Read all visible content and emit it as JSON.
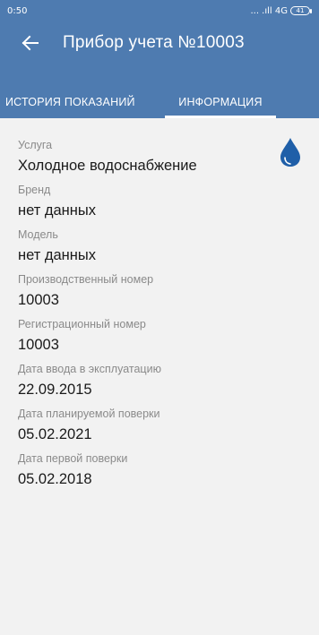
{
  "status_bar": {
    "time": "0:50",
    "network": "... .ıll 4G",
    "battery": "41"
  },
  "toolbar": {
    "title": "Прибор учета №10003",
    "back_icon": "arrow-left-icon"
  },
  "tabs": [
    {
      "label": "ИСТОРИЯ ПОКАЗАНИЙ",
      "active": false
    },
    {
      "label": "ИНФОРМАЦИЯ",
      "active": true
    }
  ],
  "colors": {
    "header": "#4e7bb0",
    "background": "#f2f2f2",
    "drop_icon": "#1f5fa8"
  },
  "service_icon": "water-drop-icon",
  "fields": [
    {
      "label": "Услуга",
      "value": "Холодное водоснабжение"
    },
    {
      "label": "Бренд",
      "value": "нет данных"
    },
    {
      "label": "Модель",
      "value": "нет данных"
    },
    {
      "label": "Производственный номер",
      "value": "10003"
    },
    {
      "label": "Регистрационный номер",
      "value": "10003"
    },
    {
      "label": "Дата ввода в эксплуатацию",
      "value": "22.09.2015"
    },
    {
      "label": "Дата планируемой поверки",
      "value": "05.02.2021"
    },
    {
      "label": "Дата первой поверки",
      "value": "05.02.2018"
    }
  ]
}
